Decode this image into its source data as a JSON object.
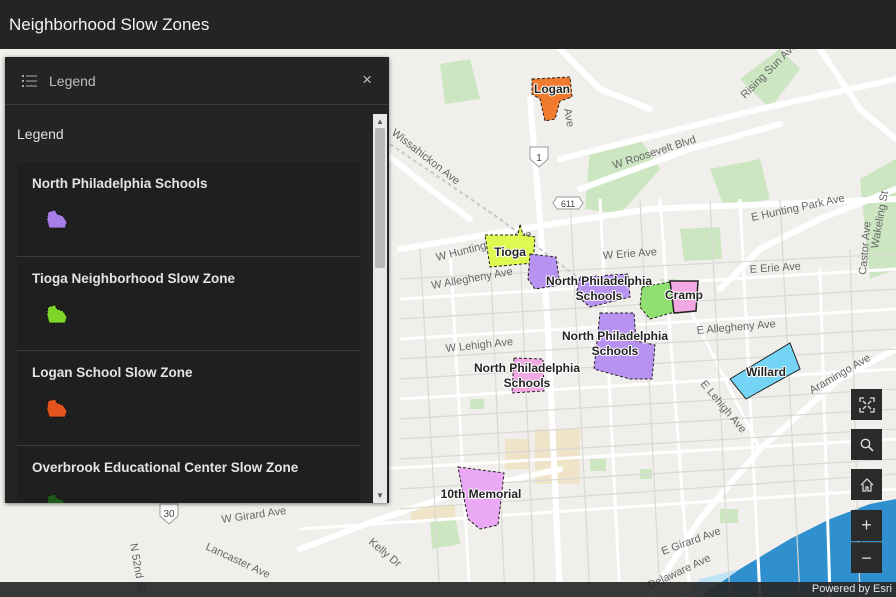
{
  "app": {
    "title": "Neighborhood Slow Zones"
  },
  "legend_panel": {
    "header_title": "Legend",
    "close_glyph": "×",
    "subtitle": "Legend",
    "items": [
      {
        "label": "North Philadelphia Schools",
        "color": "#a77de6"
      },
      {
        "label": "Tioga Neighborhood Slow Zone",
        "color": "#7fd42a"
      },
      {
        "label": "Logan School Slow Zone",
        "color": "#e5531f"
      },
      {
        "label": "Overbrook Educational Center Slow Zone",
        "color": "#1e5a1e"
      }
    ]
  },
  "map": {
    "zones": [
      {
        "label": "Logan",
        "color": "#f07a2e"
      },
      {
        "label": "Tioga",
        "color": "#dcfa50"
      },
      {
        "label": "North Philadelphia Schools",
        "color": "#b892f0"
      },
      {
        "label": "North Philadelphia Schools",
        "color": "#b892f0"
      },
      {
        "label": "North Philadelphia Schools",
        "color": "#b892f0"
      },
      {
        "label": "Cramp",
        "color": "#f2a8e2"
      },
      {
        "label": "Willard",
        "color": "#74d4f5"
      },
      {
        "label": "10th Memorial",
        "color": "#eaa8f5"
      }
    ],
    "street_labels": [
      "W Roosevelt Blvd",
      "W Hunting Park Ave",
      "W Erie Ave",
      "E Erie Ave",
      "W Allegheny Ave",
      "E Allegheny Ave",
      "W Lehigh Ave",
      "E Lehigh Ave",
      "W Girard Ave",
      "E Girard Ave",
      "Wissahickon Ave",
      "Aramingo Ave",
      "Castor Ave",
      "Wakeling St",
      "Lancaster Ave",
      "N 52nd St",
      "Delaware Ave",
      "Kelly Dr",
      "E Hunting Park Ave",
      "Rising Sun Ave",
      "Ave"
    ],
    "route_shields": [
      "1",
      "611",
      "30"
    ]
  },
  "controls": {
    "fullscreen": "fullscreen-icon",
    "search": "search-icon",
    "home": "home-icon",
    "zoom_in": "+",
    "zoom_out": "−"
  },
  "attribution": "Powered by Esri"
}
